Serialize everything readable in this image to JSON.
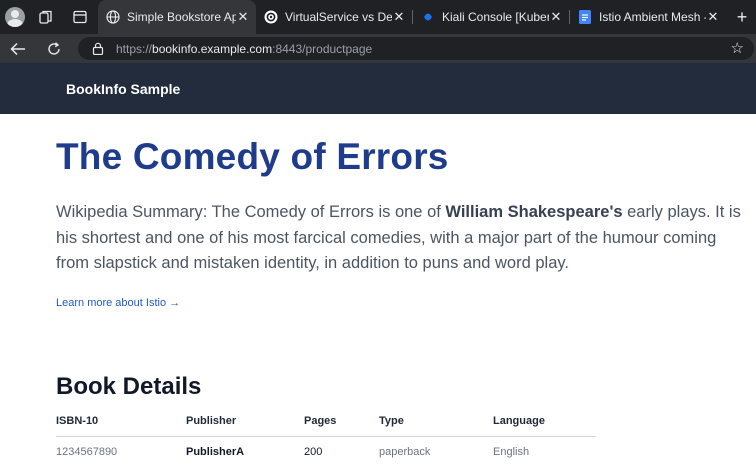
{
  "browser": {
    "tabs": [
      {
        "title": "Simple Bookstore App",
        "icon": "globe-icon",
        "active": true
      },
      {
        "title": "VirtualService vs Destinati",
        "icon": "openai-icon"
      },
      {
        "title": "Kiali Console [Kubernete",
        "icon": "kiali-icon"
      },
      {
        "title": "Istio Ambient Mesh - Goo",
        "icon": "docs-icon"
      }
    ],
    "url": {
      "scheme": "https://",
      "host": "bookinfo.example.com",
      "rest": ":8443/productpage"
    }
  },
  "page": {
    "brand": "BookInfo Sample",
    "title": "The Comedy of Errors",
    "summary": {
      "before": "Wikipedia Summary: The Comedy of Errors is one of ",
      "bold": "William Shakespeare's",
      "after": " early plays. It is his shortest and one of his most farcical comedies, with a major part of the humour coming from slapstick and mistaken identity, in addition to puns and word play."
    },
    "learn_more": "Learn more about Istio →",
    "details": {
      "heading": "Book Details",
      "headers": [
        "ISBN-10",
        "Publisher",
        "Pages",
        "Type",
        "Language"
      ],
      "row": [
        "1234567890",
        "PublisherA",
        "200",
        "paperback",
        "English"
      ]
    }
  },
  "colors": {
    "navbar": "#222c3c",
    "title": "#1f3b8c",
    "link": "#1f5bc6"
  }
}
